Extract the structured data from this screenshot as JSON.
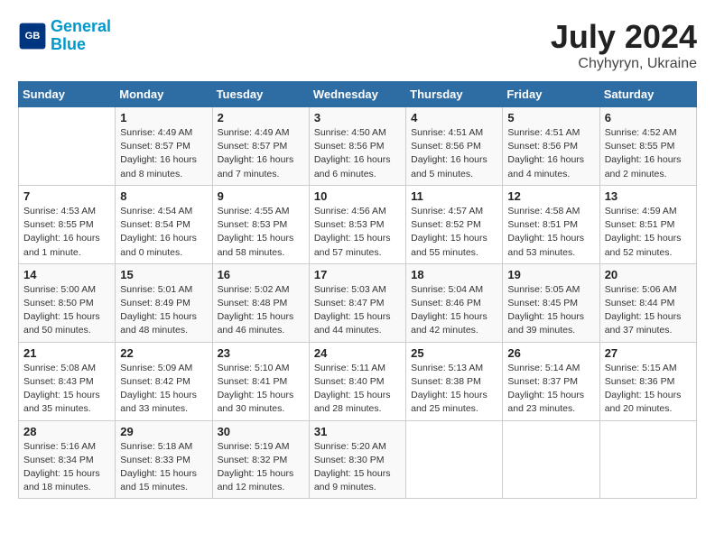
{
  "header": {
    "logo_general": "General",
    "logo_blue": "Blue",
    "month_year": "July 2024",
    "location": "Chyhyryn, Ukraine"
  },
  "columns": [
    "Sunday",
    "Monday",
    "Tuesday",
    "Wednesday",
    "Thursday",
    "Friday",
    "Saturday"
  ],
  "weeks": [
    [
      {
        "day": "",
        "sunrise": "",
        "sunset": "",
        "daylight": ""
      },
      {
        "day": "1",
        "sunrise": "Sunrise: 4:49 AM",
        "sunset": "Sunset: 8:57 PM",
        "daylight": "Daylight: 16 hours and 8 minutes."
      },
      {
        "day": "2",
        "sunrise": "Sunrise: 4:49 AM",
        "sunset": "Sunset: 8:57 PM",
        "daylight": "Daylight: 16 hours and 7 minutes."
      },
      {
        "day": "3",
        "sunrise": "Sunrise: 4:50 AM",
        "sunset": "Sunset: 8:56 PM",
        "daylight": "Daylight: 16 hours and 6 minutes."
      },
      {
        "day": "4",
        "sunrise": "Sunrise: 4:51 AM",
        "sunset": "Sunset: 8:56 PM",
        "daylight": "Daylight: 16 hours and 5 minutes."
      },
      {
        "day": "5",
        "sunrise": "Sunrise: 4:51 AM",
        "sunset": "Sunset: 8:56 PM",
        "daylight": "Daylight: 16 hours and 4 minutes."
      },
      {
        "day": "6",
        "sunrise": "Sunrise: 4:52 AM",
        "sunset": "Sunset: 8:55 PM",
        "daylight": "Daylight: 16 hours and 2 minutes."
      }
    ],
    [
      {
        "day": "7",
        "sunrise": "Sunrise: 4:53 AM",
        "sunset": "Sunset: 8:55 PM",
        "daylight": "Daylight: 16 hours and 1 minute."
      },
      {
        "day": "8",
        "sunrise": "Sunrise: 4:54 AM",
        "sunset": "Sunset: 8:54 PM",
        "daylight": "Daylight: 16 hours and 0 minutes."
      },
      {
        "day": "9",
        "sunrise": "Sunrise: 4:55 AM",
        "sunset": "Sunset: 8:53 PM",
        "daylight": "Daylight: 15 hours and 58 minutes."
      },
      {
        "day": "10",
        "sunrise": "Sunrise: 4:56 AM",
        "sunset": "Sunset: 8:53 PM",
        "daylight": "Daylight: 15 hours and 57 minutes."
      },
      {
        "day": "11",
        "sunrise": "Sunrise: 4:57 AM",
        "sunset": "Sunset: 8:52 PM",
        "daylight": "Daylight: 15 hours and 55 minutes."
      },
      {
        "day": "12",
        "sunrise": "Sunrise: 4:58 AM",
        "sunset": "Sunset: 8:51 PM",
        "daylight": "Daylight: 15 hours and 53 minutes."
      },
      {
        "day": "13",
        "sunrise": "Sunrise: 4:59 AM",
        "sunset": "Sunset: 8:51 PM",
        "daylight": "Daylight: 15 hours and 52 minutes."
      }
    ],
    [
      {
        "day": "14",
        "sunrise": "Sunrise: 5:00 AM",
        "sunset": "Sunset: 8:50 PM",
        "daylight": "Daylight: 15 hours and 50 minutes."
      },
      {
        "day": "15",
        "sunrise": "Sunrise: 5:01 AM",
        "sunset": "Sunset: 8:49 PM",
        "daylight": "Daylight: 15 hours and 48 minutes."
      },
      {
        "day": "16",
        "sunrise": "Sunrise: 5:02 AM",
        "sunset": "Sunset: 8:48 PM",
        "daylight": "Daylight: 15 hours and 46 minutes."
      },
      {
        "day": "17",
        "sunrise": "Sunrise: 5:03 AM",
        "sunset": "Sunset: 8:47 PM",
        "daylight": "Daylight: 15 hours and 44 minutes."
      },
      {
        "day": "18",
        "sunrise": "Sunrise: 5:04 AM",
        "sunset": "Sunset: 8:46 PM",
        "daylight": "Daylight: 15 hours and 42 minutes."
      },
      {
        "day": "19",
        "sunrise": "Sunrise: 5:05 AM",
        "sunset": "Sunset: 8:45 PM",
        "daylight": "Daylight: 15 hours and 39 minutes."
      },
      {
        "day": "20",
        "sunrise": "Sunrise: 5:06 AM",
        "sunset": "Sunset: 8:44 PM",
        "daylight": "Daylight: 15 hours and 37 minutes."
      }
    ],
    [
      {
        "day": "21",
        "sunrise": "Sunrise: 5:08 AM",
        "sunset": "Sunset: 8:43 PM",
        "daylight": "Daylight: 15 hours and 35 minutes."
      },
      {
        "day": "22",
        "sunrise": "Sunrise: 5:09 AM",
        "sunset": "Sunset: 8:42 PM",
        "daylight": "Daylight: 15 hours and 33 minutes."
      },
      {
        "day": "23",
        "sunrise": "Sunrise: 5:10 AM",
        "sunset": "Sunset: 8:41 PM",
        "daylight": "Daylight: 15 hours and 30 minutes."
      },
      {
        "day": "24",
        "sunrise": "Sunrise: 5:11 AM",
        "sunset": "Sunset: 8:40 PM",
        "daylight": "Daylight: 15 hours and 28 minutes."
      },
      {
        "day": "25",
        "sunrise": "Sunrise: 5:13 AM",
        "sunset": "Sunset: 8:38 PM",
        "daylight": "Daylight: 15 hours and 25 minutes."
      },
      {
        "day": "26",
        "sunrise": "Sunrise: 5:14 AM",
        "sunset": "Sunset: 8:37 PM",
        "daylight": "Daylight: 15 hours and 23 minutes."
      },
      {
        "day": "27",
        "sunrise": "Sunrise: 5:15 AM",
        "sunset": "Sunset: 8:36 PM",
        "daylight": "Daylight: 15 hours and 20 minutes."
      }
    ],
    [
      {
        "day": "28",
        "sunrise": "Sunrise: 5:16 AM",
        "sunset": "Sunset: 8:34 PM",
        "daylight": "Daylight: 15 hours and 18 minutes."
      },
      {
        "day": "29",
        "sunrise": "Sunrise: 5:18 AM",
        "sunset": "Sunset: 8:33 PM",
        "daylight": "Daylight: 15 hours and 15 minutes."
      },
      {
        "day": "30",
        "sunrise": "Sunrise: 5:19 AM",
        "sunset": "Sunset: 8:32 PM",
        "daylight": "Daylight: 15 hours and 12 minutes."
      },
      {
        "day": "31",
        "sunrise": "Sunrise: 5:20 AM",
        "sunset": "Sunset: 8:30 PM",
        "daylight": "Daylight: 15 hours and 9 minutes."
      },
      {
        "day": "",
        "sunrise": "",
        "sunset": "",
        "daylight": ""
      },
      {
        "day": "",
        "sunrise": "",
        "sunset": "",
        "daylight": ""
      },
      {
        "day": "",
        "sunrise": "",
        "sunset": "",
        "daylight": ""
      }
    ]
  ]
}
